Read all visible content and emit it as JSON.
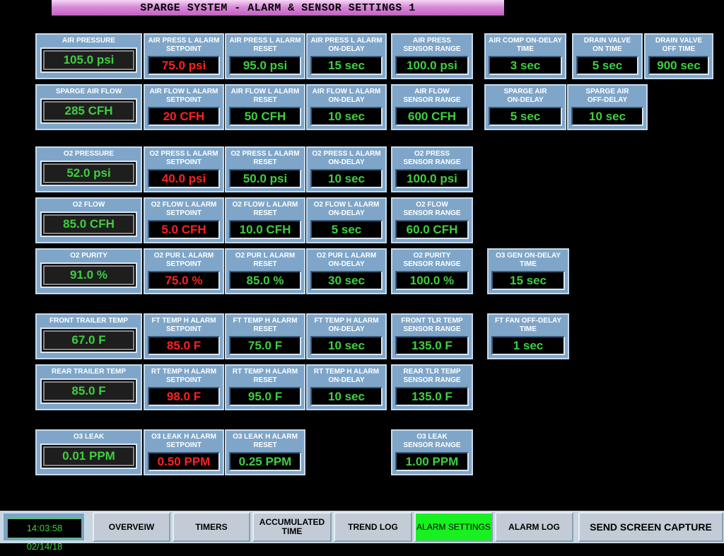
{
  "title": "SPARGE SYSTEM - ALARM & SENSOR SETTINGS 1",
  "colors": {
    "ok": "#3ecf3e",
    "alarm": "#ff2020",
    "tile": "#7fa6c9",
    "active_nav": "#19f021"
  },
  "rows": {
    "air_pressure": {
      "label": "AIR PRESSURE",
      "value": "105.0 psi"
    },
    "air_press_l_setpoint": {
      "label": "AIR PRESS L ALARM\nSETPOINT",
      "value": "75.0 psi"
    },
    "air_press_l_reset": {
      "label": "AIR PRESS L ALARM\nRESET",
      "value": "95.0 psi"
    },
    "air_press_l_ondelay": {
      "label": "AIR PRESS L ALARM\nON-DELAY",
      "value": "15 sec"
    },
    "air_press_range": {
      "label": "AIR PRESS\nSENSOR RANGE",
      "value": "100.0 psi"
    },
    "air_comp_ondelay": {
      "label": "AIR COMP ON-DELAY\nTIME",
      "value": "3 sec"
    },
    "drain_on": {
      "label": "DRAIN VALVE\nON TIME",
      "value": "5 sec"
    },
    "drain_off": {
      "label": "DRAIN VALVE\nOFF TIME",
      "value": "900 sec"
    },
    "sparge_air_flow": {
      "label": "SPARGE AIR FLOW",
      "value": "285 CFH"
    },
    "air_flow_l_setpoint": {
      "label": "AIR FLOW L ALARM\nSETPOINT",
      "value": "20 CFH"
    },
    "air_flow_l_reset": {
      "label": "AIR FLOW L ALARM\nRESET",
      "value": "50 CFH"
    },
    "air_flow_l_ondelay": {
      "label": "AIR FLOW L ALARM\nON-DELAY",
      "value": "10 sec"
    },
    "air_flow_range": {
      "label": "AIR FLOW\nSENSOR RANGE",
      "value": "600 CFH"
    },
    "sparge_air_ondelay": {
      "label": "SPARGE AIR\nON-DELAY",
      "value": "5 sec"
    },
    "sparge_air_offdelay": {
      "label": "SPARGE AIR\nOFF-DELAY",
      "value": "10 sec"
    },
    "o2_pressure": {
      "label": "O2 PRESSURE",
      "value": "52.0 psi"
    },
    "o2_press_l_setpoint": {
      "label": "O2 PRESS L ALARM\nSETPOINT",
      "value": "40.0 psi"
    },
    "o2_press_l_reset": {
      "label": "O2 PRESS L ALARM\nRESET",
      "value": "50.0 psi"
    },
    "o2_press_l_ondelay": {
      "label": "O2 PRESS L ALARM\nON-DELAY",
      "value": "10 sec"
    },
    "o2_press_range": {
      "label": "O2 PRESS\nSENSOR RANGE",
      "value": "100.0 psi"
    },
    "o2_flow": {
      "label": "O2 FLOW",
      "value": "85.0 CFH"
    },
    "o2_flow_l_setpoint": {
      "label": "O2 FLOW L ALARM\nSETPOINT",
      "value": "5.0 CFH"
    },
    "o2_flow_l_reset": {
      "label": "O2 FLOW L ALARM\nRESET",
      "value": "10.0 CFH"
    },
    "o2_flow_l_ondelay": {
      "label": "O2 FLOW L ALARM\nON-DELAY",
      "value": "5 sec"
    },
    "o2_flow_range": {
      "label": "O2 FLOW\nSENSOR RANGE",
      "value": "60.0 CFH"
    },
    "o2_purity": {
      "label": "O2 PURITY",
      "value": "91.0 %"
    },
    "o2_pur_l_setpoint": {
      "label": "O2 PUR L ALARM\nSETPOINT",
      "value": "75.0 %"
    },
    "o2_pur_l_reset": {
      "label": "O2 PUR L ALARM\nRESET",
      "value": "85.0 %"
    },
    "o2_pur_l_ondelay": {
      "label": "O2 PUR L ALARM\nON-DELAY",
      "value": "30 sec"
    },
    "o2_purity_range": {
      "label": "O2 PURITY\nSENSOR RANGE",
      "value": "100.0 %"
    },
    "o3_gen_ondelay": {
      "label": "O3 GEN ON-DELAY\nTIME",
      "value": "15 sec"
    },
    "front_trailer_temp": {
      "label": "FRONT TRAILER TEMP",
      "value": "67.0 F"
    },
    "ft_temp_h_setpoint": {
      "label": "FT TEMP H ALARM\nSETPOINT",
      "value": "85.0 F"
    },
    "ft_temp_h_reset": {
      "label": "FT TEMP H ALARM\nRESET",
      "value": "75.0 F"
    },
    "ft_temp_h_ondelay": {
      "label": "FT TEMP H ALARM\nON-DELAY",
      "value": "10 sec"
    },
    "front_tlr_range": {
      "label": "FRONT TLR TEMP\nSENSOR RANGE",
      "value": "135.0 F"
    },
    "ft_fan_offdelay": {
      "label": "FT FAN OFF-DELAY\nTIME",
      "value": "1 sec"
    },
    "rear_trailer_temp": {
      "label": "REAR TRAILER TEMP",
      "value": "85.0 F"
    },
    "rt_temp_h_setpoint": {
      "label": "RT TEMP H ALARM\nSETPOINT",
      "value": "98.0 F"
    },
    "rt_temp_h_reset": {
      "label": "RT TEMP H ALARM\nRESET",
      "value": "95.0 F"
    },
    "rt_temp_h_ondelay": {
      "label": "RT TEMP H ALARM\nON-DELAY",
      "value": "10 sec"
    },
    "rear_tlr_range": {
      "label": "REAR TLR TEMP\nSENSOR RANGE",
      "value": "135.0 F"
    },
    "o3_leak": {
      "label": "O3 LEAK",
      "value": "0.01 PPM"
    },
    "o3_leak_h_setpoint": {
      "label": "O3 LEAK H ALARM\nSETPOINT",
      "value": "0.50 PPM"
    },
    "o3_leak_h_reset": {
      "label": "O3 LEAK H ALARM\nRESET",
      "value": "0.25 PPM"
    },
    "o3_leak_range": {
      "label": "O3 LEAK\nSENSOR RANGE",
      "value": "1.00 PPM"
    }
  },
  "clock": "14:03:58 02/14/18",
  "nav": {
    "overview": "OVERVEIW",
    "timers": "TIMERS",
    "accumulated": "ACCUMULATED\nTIME",
    "trend": "TREND LOG",
    "alarm_settings": "ALARM SETTINGS",
    "alarm_log": "ALARM LOG",
    "capture": "SEND SCREEN CAPTURE"
  }
}
